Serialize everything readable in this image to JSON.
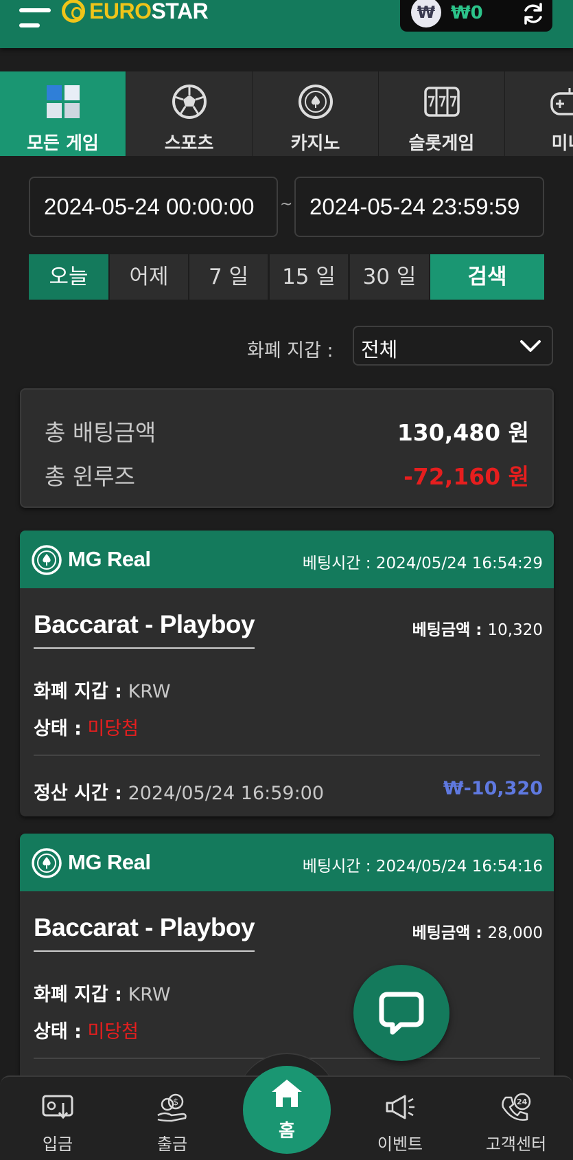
{
  "header": {
    "logo_prefix": "EURO",
    "logo_suffix": "STAR",
    "currency_symbol": "₩",
    "balance": "₩0"
  },
  "game_tabs": [
    {
      "label": "모든 게임",
      "icon": "cube-icon",
      "active": true
    },
    {
      "label": "스포츠",
      "icon": "soccer-ball-icon",
      "active": false
    },
    {
      "label": "카지노",
      "icon": "casino-chip-icon",
      "active": false
    },
    {
      "label": "슬롯게임",
      "icon": "slot-machine-icon",
      "active": false
    },
    {
      "label": "미니",
      "icon": "gamepad-icon",
      "active": false
    }
  ],
  "filter": {
    "date_from": "2024-05-24 00:00:00",
    "date_to": "2024-05-24 23:59:59",
    "separator": "~",
    "periods": [
      "오늘",
      "어제",
      "7 일",
      "15 일",
      "30 일"
    ],
    "active_period": "오늘",
    "search_label": "검색",
    "currency_label": "화폐 지갑 :",
    "currency_value": "전체"
  },
  "summary": {
    "total_bet_label": "총 배팅금액",
    "total_bet_value": "130,480 원",
    "total_winloss_label": "총 윈루즈",
    "total_winloss_value": "-72,160 원"
  },
  "bets": [
    {
      "provider": "MG Real",
      "bet_time_label": "베팅시간 :",
      "bet_time": "2024/05/24 16:54:29",
      "game": "Baccarat - Playboy",
      "amount_label": "베팅금액 :",
      "amount": "10,320",
      "currency_label": "화폐 지갑 :",
      "currency": "KRW",
      "status_label": "상태 :",
      "status": "미당첨",
      "settle_label": "정산 시간 :",
      "settle_time": "2024/05/24 16:59:00",
      "settle_amount": "₩-10,320"
    },
    {
      "provider": "MG Real",
      "bet_time_label": "베팅시간 :",
      "bet_time": "2024/05/24 16:54:16",
      "game": "Baccarat - Playboy",
      "amount_label": "베팅금액 :",
      "amount": "28,000",
      "currency_label": "화폐 지갑 :",
      "currency": "KRW",
      "status_label": "상태 :",
      "status": "미당첨"
    }
  ],
  "bottom_nav": {
    "deposit": "입금",
    "withdraw": "출금",
    "home": "홈",
    "event": "이벤트",
    "support": "고객센터"
  },
  "colors": {
    "brand_green": "#147a5c",
    "accent_green": "#1a9672",
    "loss_red": "#e61e1e",
    "settle_blue": "#5f79e0",
    "logo_yellow": "#f0c419"
  }
}
